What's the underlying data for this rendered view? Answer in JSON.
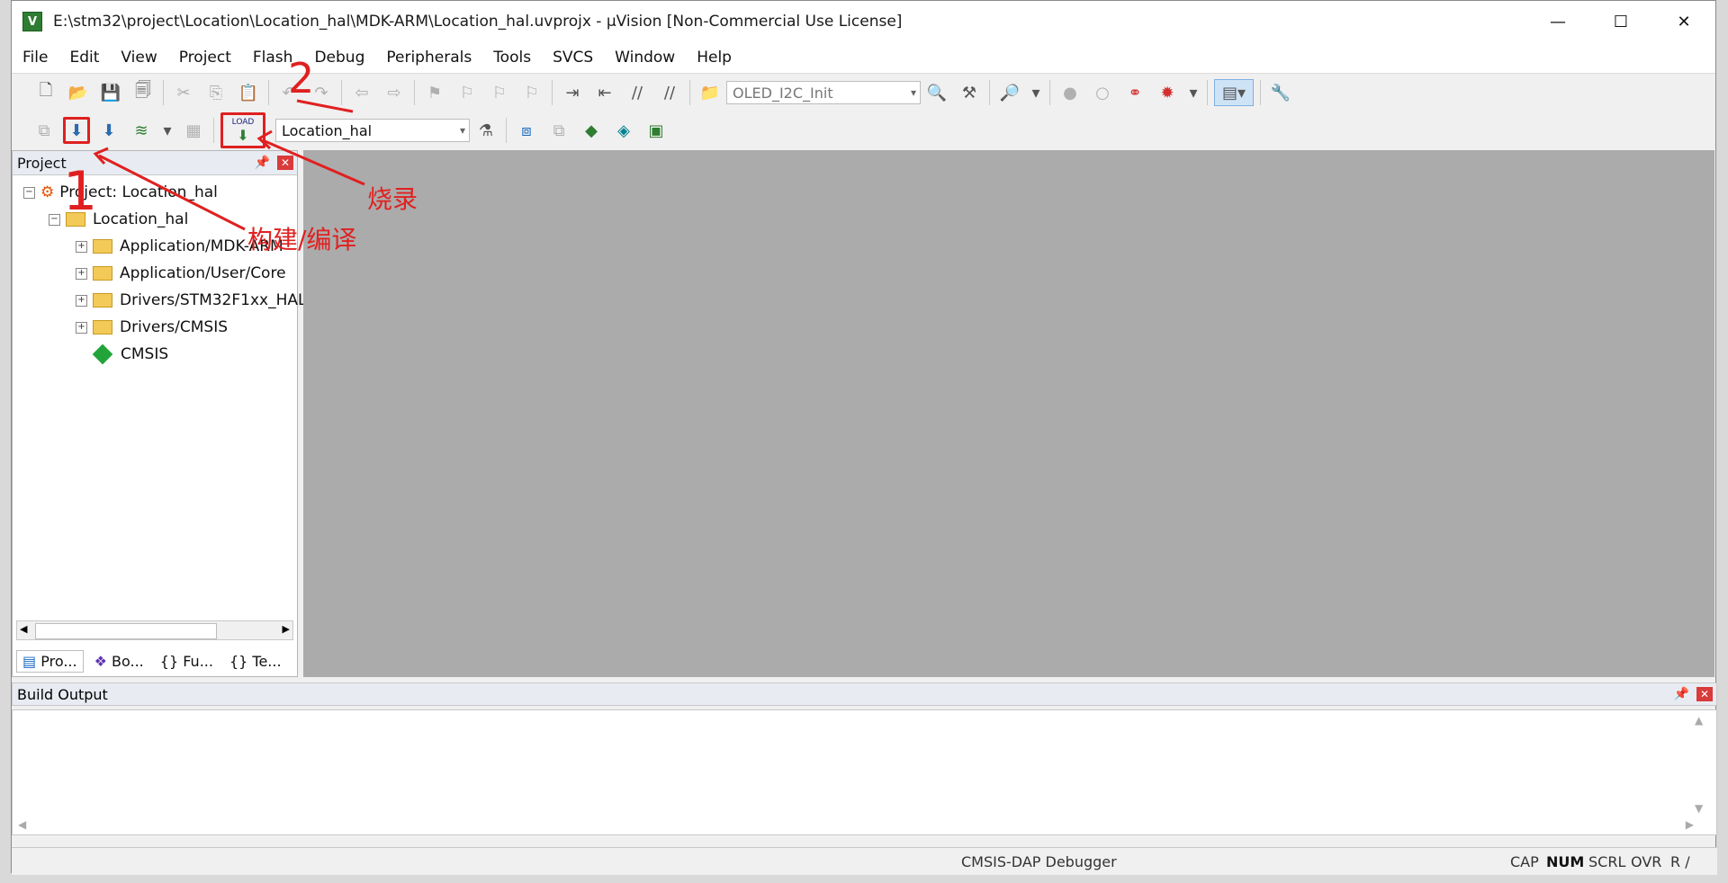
{
  "window": {
    "title": "E:\\stm32\\project\\Location\\Location_hal\\MDK-ARM\\Location_hal.uvprojx - µVision  [Non-Commercial Use License]",
    "minimize": "—",
    "maximize": "☐",
    "close": "✕"
  },
  "menu": [
    "File",
    "Edit",
    "View",
    "Project",
    "Flash",
    "Debug",
    "Peripherals",
    "Tools",
    "SVCS",
    "Window",
    "Help"
  ],
  "toolbar1": {
    "find_combo": "OLED_I2C_Init"
  },
  "toolbar2": {
    "load_label": "LOAD",
    "target_combo": "Location_hal"
  },
  "project_panel": {
    "title": "Project",
    "root": "Project: Location_hal",
    "target": "Location_hal",
    "groups": [
      "Application/MDK-ARM",
      "Application/User/Core",
      "Drivers/STM32F1xx_HAL",
      "Drivers/CMSIS"
    ],
    "cmsis": "CMSIS",
    "tabs": [
      "Pro...",
      "Bo...",
      "Fu...",
      "Te..."
    ]
  },
  "build_output": {
    "title": "Build Output"
  },
  "status": {
    "debugger": "CMSIS-DAP Debugger",
    "cap": "CAP",
    "num": "NUM",
    "scrl": "SCRL",
    "ovr": "OVR",
    "rw": "R /"
  },
  "annotations": {
    "one": "1",
    "two": "2",
    "build": "构建/编译",
    "flash": "烧录"
  },
  "colors": {
    "annotation": "#e02020",
    "editor_bg": "#ababab"
  }
}
